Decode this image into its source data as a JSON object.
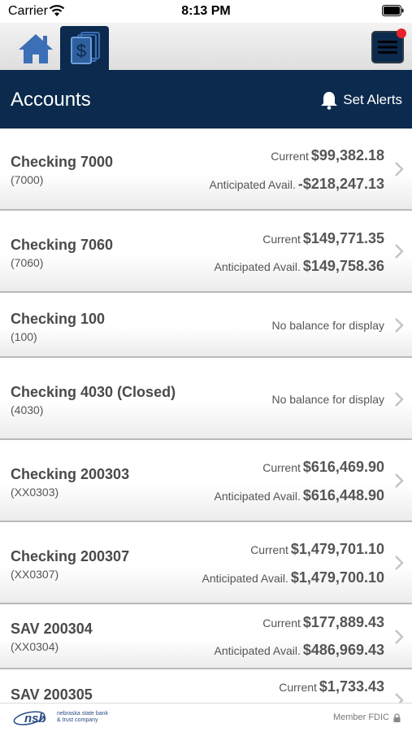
{
  "status_bar": {
    "carrier": "Carrier",
    "time": "8:13 PM"
  },
  "tabs": [
    {
      "name": "home",
      "icon": "home-icon"
    },
    {
      "name": "accounts",
      "icon": "dollar-document-icon"
    }
  ],
  "header": {
    "title": "Accounts",
    "alerts_label": "Set Alerts"
  },
  "accounts": [
    {
      "name": "Checking 7000",
      "number": "(7000)",
      "current_label": "Current",
      "current": "$99,382.18",
      "anticipated_label": "Anticipated Avail.",
      "anticipated": "-$218,247.13"
    },
    {
      "name": "Checking 7060",
      "number": "(7060)",
      "current_label": "Current",
      "current": "$149,771.35",
      "anticipated_label": "Anticipated Avail.",
      "anticipated": "$149,758.36"
    },
    {
      "name": "Checking 100",
      "number": "(100)",
      "no_balance": "No balance for display"
    },
    {
      "name": "Checking 4030 (Closed)",
      "number": "(4030)",
      "no_balance": "No balance for display"
    },
    {
      "name": "Checking 200303",
      "number": "(XX0303)",
      "current_label": "Current",
      "current": "$616,469.90",
      "anticipated_label": "Anticipated Avail.",
      "anticipated": "$616,448.90"
    },
    {
      "name": "Checking 200307",
      "number": "(XX0307)",
      "current_label": "Current",
      "current": "$1,479,701.10",
      "anticipated_label": "Anticipated Avail.",
      "anticipated": "$1,479,700.10"
    },
    {
      "name": "SAV 200304",
      "number": "(XX0304)",
      "current_label": "Current",
      "current": "$177,889.43",
      "anticipated_label": "Anticipated Avail.",
      "anticipated": "$486,969.43"
    },
    {
      "name": "SAV 200305",
      "current_label": "Current",
      "current": "$1,733.43"
    }
  ],
  "footer": {
    "logo_mark": "nsb",
    "logo_line1": "nebraska state bank",
    "logo_line2": "& trust company",
    "fdic": "Member FDIC"
  },
  "colors": {
    "navy": "#0b2a4d",
    "notification": "#e8222d",
    "home_blue": "#3b6fb6"
  }
}
